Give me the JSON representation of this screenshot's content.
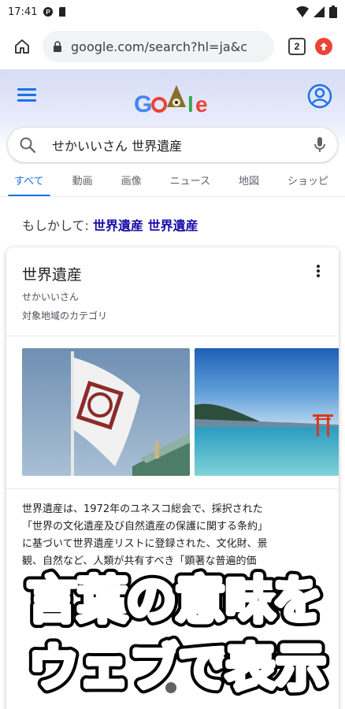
{
  "status_bar": {
    "time": "17:41"
  },
  "toolbar": {
    "url": "google.com/search?hl=ja&c",
    "tab_count": "2"
  },
  "search": {
    "query": "せかいいさん 世界遺産"
  },
  "tabs": [
    {
      "label": "すべて",
      "active": true
    },
    {
      "label": "動画"
    },
    {
      "label": "画像"
    },
    {
      "label": "ニュース"
    },
    {
      "label": "地図"
    },
    {
      "label": "ショッピ"
    }
  ],
  "did_you_mean": {
    "prefix": "もしかして: ",
    "suggestion": "世界遺産 世界遺産"
  },
  "card": {
    "title": "世界遺産",
    "reading": "せかいいさん",
    "category": "対象地域のカテゴリ",
    "description_lines": [
      "世界遺産は、1972年のユネスコ総会で、採択された",
      "「世界の文化遺産及び自然遺産の保護に関する条約」",
      "に基づいて世界遺産リストに登録された、文化財、景",
      "観、自然など、人類が共有すべき「顕著な普遍的価"
    ]
  },
  "banner": {
    "word1": "言葉",
    "word2": "の",
    "word3": "意味",
    "word4": "を",
    "word5": "ウェブ",
    "word6": "で",
    "word7": "表示"
  },
  "colors": {
    "google_blue": "#1a73e8",
    "link": "#1a0dab",
    "banner_green": "#1aa31a",
    "banner_red": "#e0141e",
    "banner_blue": "#1c3ff0",
    "banner_gold": "#c9a300"
  }
}
